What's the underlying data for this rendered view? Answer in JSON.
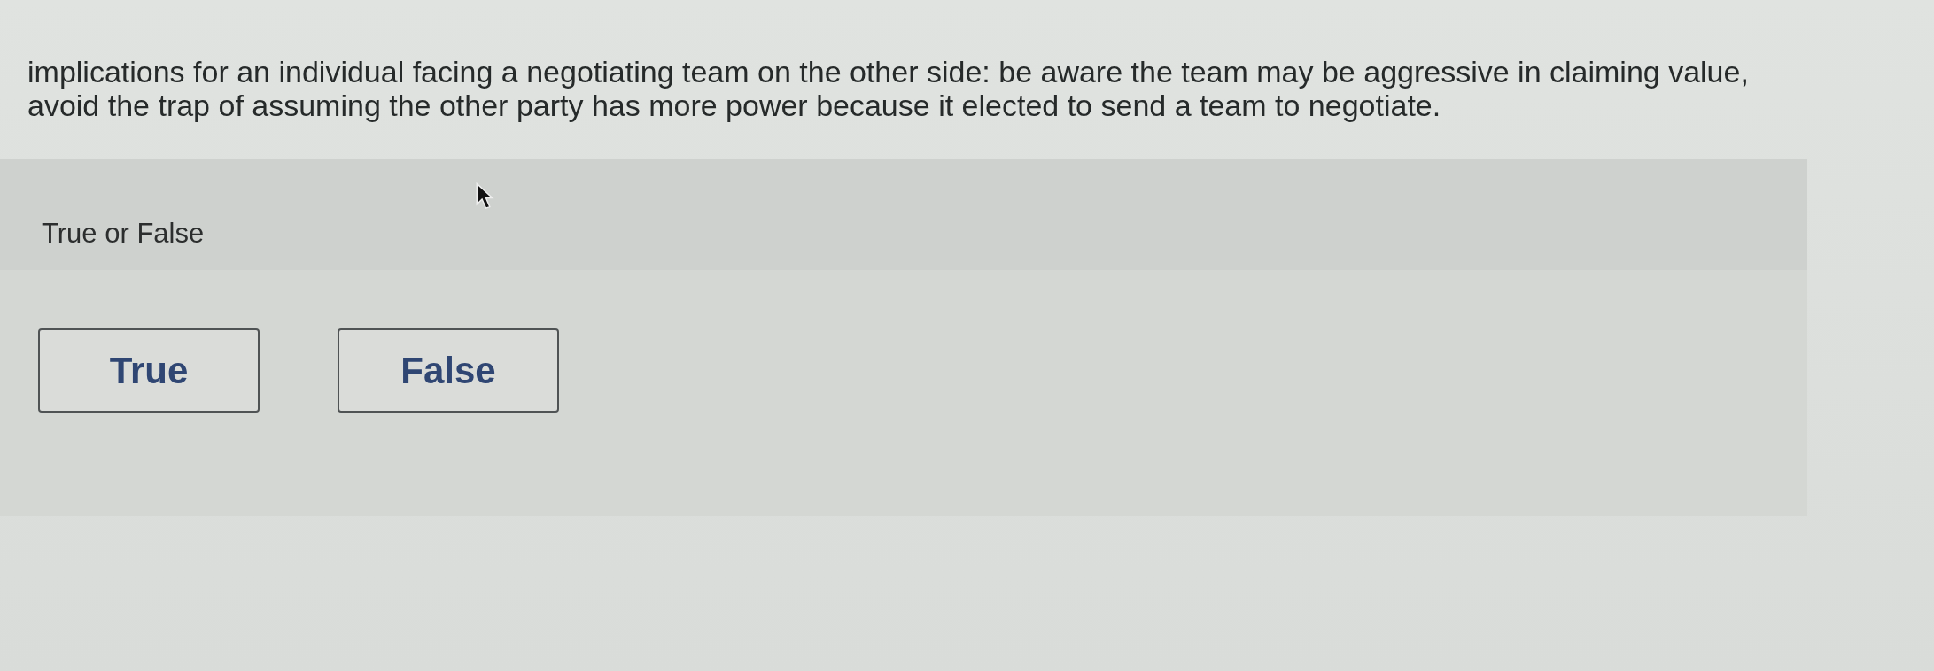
{
  "question": {
    "lines": [
      "implications for an individual facing a negotiating team on the other side: be aware the team may be aggressive in claiming value,",
      "avoid the trap of assuming the other party has more power because it elected to send a team to negotiate."
    ]
  },
  "prompt": "True or False",
  "options": [
    {
      "label": "True",
      "selected": false
    },
    {
      "label": "False",
      "selected": false
    }
  ]
}
